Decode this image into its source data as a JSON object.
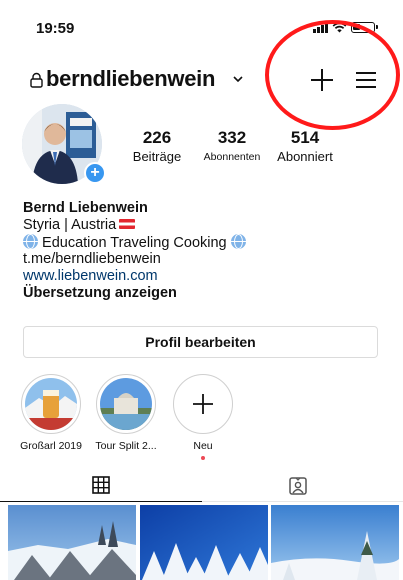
{
  "status_bar": {
    "time": "19:59"
  },
  "header": {
    "username": "berndliebenwein",
    "icons": [
      "lock-icon",
      "chevron-down-icon",
      "plus-icon",
      "hamburger-menu-icon"
    ]
  },
  "stats": [
    {
      "count": "226",
      "label": "Beiträge"
    },
    {
      "count": "332",
      "label": "Abonnenten"
    },
    {
      "count": "514",
      "label": "Abonniert"
    }
  ],
  "bio": {
    "name": "Bernd Liebenwein",
    "location": "Styria | Austria",
    "tagline": "Education Traveling Cooking",
    "telegram": "t.me/berndliebenwein",
    "website": "www.liebenwein.com",
    "translate": "Übersetzung anzeigen"
  },
  "edit_profile": {
    "label": "Profil bearbeiten"
  },
  "highlights": [
    {
      "label": "Großarl 2019"
    },
    {
      "label": "Tour Split 2..."
    },
    {
      "label": "Neu"
    }
  ],
  "tabs": [
    "grid-icon",
    "tagged-icon"
  ],
  "colors": {
    "link": "#00376b",
    "accent_blue": "#3897f0",
    "annotation_red": "#ff1a1a",
    "notification_dot": "#ed4956"
  }
}
